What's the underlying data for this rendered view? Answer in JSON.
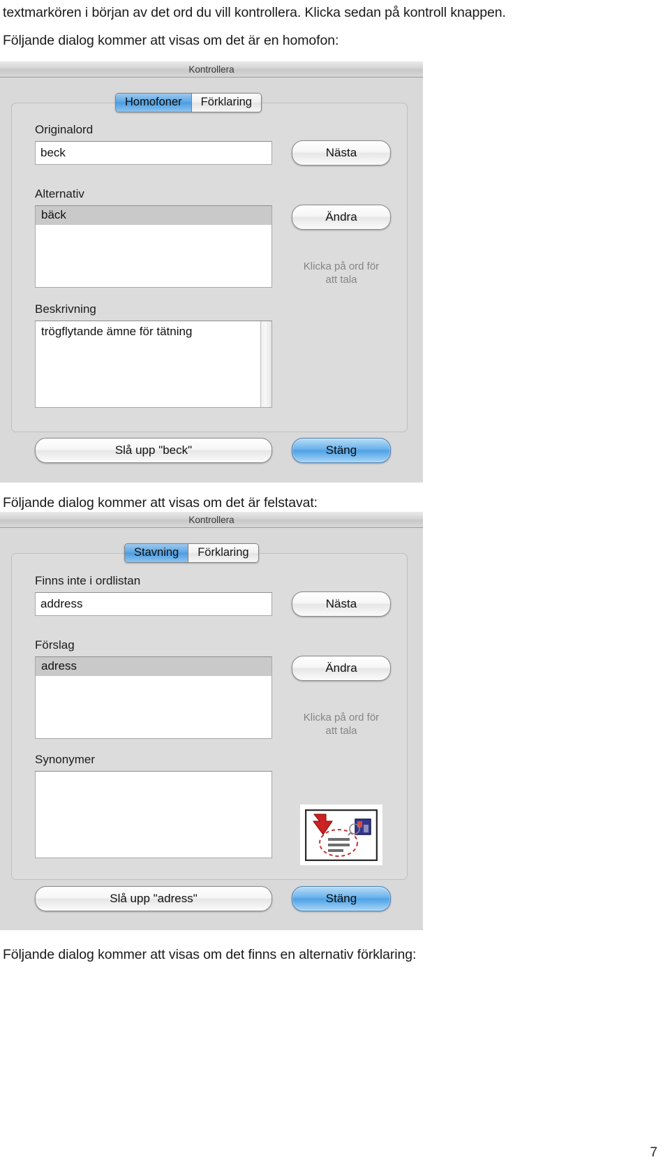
{
  "document": {
    "paragraphs": {
      "line1": "textmarkören i början av det ord du vill kontrollera. Klicka sedan på kontroll knappen.",
      "line2": "Följande dialog kommer att visas om det är en homofon:",
      "line3": "Följande dialog kommer att visas om det är felstavat:",
      "line4": "Följande dialog kommer att visas om det finns en alternativ förklaring:"
    },
    "page_number": "7"
  },
  "dialog_homophone": {
    "titlebar": "Kontrollera",
    "tabs": [
      {
        "label": "Homofoner",
        "active": true
      },
      {
        "label": "Förklaring",
        "active": false
      }
    ],
    "original_word": {
      "label": "Originalord",
      "value": "beck"
    },
    "alternatives": {
      "label": "Alternativ",
      "items": [
        "bäck"
      ],
      "selected_index": 0
    },
    "description": {
      "label": "Beskrivning",
      "value": "trögflytande ämne för tätning"
    },
    "hint": "Klicka på ord för\natt tala",
    "buttons": {
      "next": "Nästa",
      "change": "Ändra",
      "lookup": "Slå upp \"beck\"",
      "close": "Stäng"
    }
  },
  "dialog_spelling": {
    "titlebar": "Kontrollera",
    "tabs": [
      {
        "label": "Stavning",
        "active": true
      },
      {
        "label": "Förklaring",
        "active": false
      }
    ],
    "not_in_dictionary": {
      "label": "Finns inte i ordlistan",
      "value": "address"
    },
    "suggestions": {
      "label": "Förslag",
      "items": [
        "adress"
      ],
      "selected_index": 0
    },
    "synonyms": {
      "label": "Synonymer",
      "items": []
    },
    "hint": "Klicka på ord för\natt tala",
    "illustration_icon": "document-arrow-highlight-icon",
    "buttons": {
      "next": "Nästa",
      "change": "Ändra",
      "lookup": "Slå upp \"adress\"",
      "close": "Stäng"
    }
  },
  "colors": {
    "dialog_background": "#d9d9d9",
    "active_tab_blue": "#4b9ce0",
    "primary_button_blue": "#4fa2e6",
    "arrow_red": "#cc2222"
  }
}
